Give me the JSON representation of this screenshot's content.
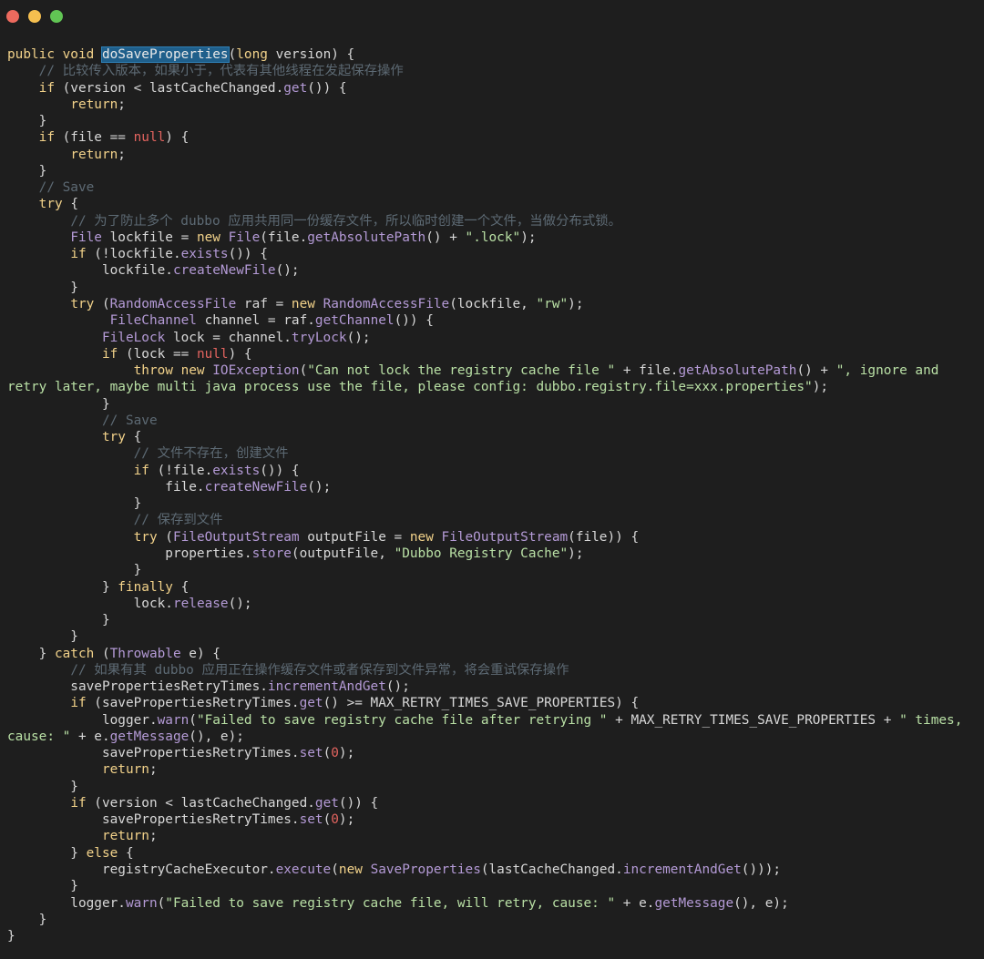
{
  "window": {
    "controls": {
      "close_color": "#ed6a5e",
      "minimize_color": "#f5bf4f",
      "maximize_color": "#61c554"
    }
  },
  "theme": {
    "background": "#1e1e1e",
    "keyword": "#f2d28a",
    "function": "#b49ad6",
    "string": "#b9e0a5",
    "number": "#e3645f",
    "comment": "#5d6a74",
    "plain": "#d8d8d8",
    "selection": "#1f5f8b"
  },
  "code": {
    "selected_identifier": "doSaveProperties",
    "lines": [
      [
        [
          "kw",
          "public void "
        ],
        [
          "hl",
          "doSaveProperties"
        ],
        [
          "op",
          "("
        ],
        [
          "kw",
          "long"
        ],
        [
          "op",
          " version) {"
        ]
      ],
      [
        [
          "op",
          "    "
        ],
        [
          "cmt",
          "// 比较传入版本，如果小于，代表有其他线程在发起保存操作"
        ]
      ],
      [
        [
          "op",
          "    "
        ],
        [
          "kw",
          "if"
        ],
        [
          "op",
          " (version < lastCacheChanged."
        ],
        [
          "fn",
          "get"
        ],
        [
          "op",
          "()) {"
        ]
      ],
      [
        [
          "op",
          "        "
        ],
        [
          "kw",
          "return"
        ],
        [
          "op",
          ";"
        ]
      ],
      [
        [
          "op",
          "    }"
        ]
      ],
      [
        [
          "op",
          "    "
        ],
        [
          "kw",
          "if"
        ],
        [
          "op",
          " (file == "
        ],
        [
          "num",
          "null"
        ],
        [
          "op",
          ") {"
        ]
      ],
      [
        [
          "op",
          "        "
        ],
        [
          "kw",
          "return"
        ],
        [
          "op",
          ";"
        ]
      ],
      [
        [
          "op",
          "    }"
        ]
      ],
      [
        [
          "op",
          "    "
        ],
        [
          "cmt",
          "// Save"
        ]
      ],
      [
        [
          "op",
          "    "
        ],
        [
          "kw",
          "try"
        ],
        [
          "op",
          " {"
        ]
      ],
      [
        [
          "op",
          "        "
        ],
        [
          "cmt",
          "// 为了防止多个 dubbo 应用共用同一份缓存文件，所以临时创建一个文件，当做分布式锁。"
        ]
      ],
      [
        [
          "op",
          "        "
        ],
        [
          "ty",
          "File"
        ],
        [
          "op",
          " lockfile = "
        ],
        [
          "kw",
          "new "
        ],
        [
          "ty",
          "File"
        ],
        [
          "op",
          "(file."
        ],
        [
          "fn",
          "getAbsolutePath"
        ],
        [
          "op",
          "() + "
        ],
        [
          "str",
          "\".lock\""
        ],
        [
          "op",
          ");"
        ]
      ],
      [
        [
          "op",
          "        "
        ],
        [
          "kw",
          "if"
        ],
        [
          "op",
          " (!lockfile."
        ],
        [
          "fn",
          "exists"
        ],
        [
          "op",
          "()) {"
        ]
      ],
      [
        [
          "op",
          "            lockfile."
        ],
        [
          "fn",
          "createNewFile"
        ],
        [
          "op",
          "();"
        ]
      ],
      [
        [
          "op",
          "        }"
        ]
      ],
      [
        [
          "op",
          "        "
        ],
        [
          "kw",
          "try"
        ],
        [
          "op",
          " ("
        ],
        [
          "ty",
          "RandomAccessFile"
        ],
        [
          "op",
          " raf = "
        ],
        [
          "kw",
          "new "
        ],
        [
          "ty",
          "RandomAccessFile"
        ],
        [
          "op",
          "(lockfile, "
        ],
        [
          "str",
          "\"rw\""
        ],
        [
          "op",
          ");"
        ]
      ],
      [
        [
          "op",
          "             "
        ],
        [
          "ty",
          "FileChannel"
        ],
        [
          "op",
          " channel = raf."
        ],
        [
          "fn",
          "getChannel"
        ],
        [
          "op",
          "()) {"
        ]
      ],
      [
        [
          "op",
          "            "
        ],
        [
          "ty",
          "FileLock"
        ],
        [
          "op",
          " lock = channel."
        ],
        [
          "fn",
          "tryLock"
        ],
        [
          "op",
          "();"
        ]
      ],
      [
        [
          "op",
          "            "
        ],
        [
          "kw",
          "if"
        ],
        [
          "op",
          " (lock == "
        ],
        [
          "num",
          "null"
        ],
        [
          "op",
          ") {"
        ]
      ],
      [
        [
          "op",
          "                "
        ],
        [
          "kw",
          "throw new "
        ],
        [
          "ty",
          "IOException"
        ],
        [
          "op",
          "("
        ],
        [
          "str",
          "\"Can not lock the registry cache file \""
        ],
        [
          "op",
          " + file."
        ],
        [
          "fn",
          "getAbsolutePath"
        ],
        [
          "op",
          "() + "
        ],
        [
          "str",
          "\", ignore and"
        ]
      ],
      [
        [
          "str",
          "retry later, maybe multi java process use the file, please config: dubbo.registry.file=xxx.properties\""
        ],
        [
          "op",
          ");"
        ]
      ],
      [
        [
          "op",
          "            }"
        ]
      ],
      [
        [
          "op",
          "            "
        ],
        [
          "cmt",
          "// Save"
        ]
      ],
      [
        [
          "op",
          "            "
        ],
        [
          "kw",
          "try"
        ],
        [
          "op",
          " {"
        ]
      ],
      [
        [
          "op",
          "                "
        ],
        [
          "cmt",
          "// 文件不存在，创建文件"
        ]
      ],
      [
        [
          "op",
          "                "
        ],
        [
          "kw",
          "if"
        ],
        [
          "op",
          " (!file."
        ],
        [
          "fn",
          "exists"
        ],
        [
          "op",
          "()) {"
        ]
      ],
      [
        [
          "op",
          "                    file."
        ],
        [
          "fn",
          "createNewFile"
        ],
        [
          "op",
          "();"
        ]
      ],
      [
        [
          "op",
          "                }"
        ]
      ],
      [
        [
          "op",
          "                "
        ],
        [
          "cmt",
          "// 保存到文件"
        ]
      ],
      [
        [
          "op",
          "                "
        ],
        [
          "kw",
          "try"
        ],
        [
          "op",
          " ("
        ],
        [
          "ty",
          "FileOutputStream"
        ],
        [
          "op",
          " outputFile = "
        ],
        [
          "kw",
          "new "
        ],
        [
          "ty",
          "FileOutputStream"
        ],
        [
          "op",
          "(file)) {"
        ]
      ],
      [
        [
          "op",
          "                    properties."
        ],
        [
          "fn",
          "store"
        ],
        [
          "op",
          "(outputFile, "
        ],
        [
          "str",
          "\"Dubbo Registry Cache\""
        ],
        [
          "op",
          ");"
        ]
      ],
      [
        [
          "op",
          "                }"
        ]
      ],
      [
        [
          "op",
          "            } "
        ],
        [
          "kw",
          "finally"
        ],
        [
          "op",
          " {"
        ]
      ],
      [
        [
          "op",
          "                lock."
        ],
        [
          "fn",
          "release"
        ],
        [
          "op",
          "();"
        ]
      ],
      [
        [
          "op",
          "            }"
        ]
      ],
      [
        [
          "op",
          "        }"
        ]
      ],
      [
        [
          "op",
          "    } "
        ],
        [
          "kw",
          "catch"
        ],
        [
          "op",
          " ("
        ],
        [
          "ty",
          "Throwable"
        ],
        [
          "op",
          " e) {"
        ]
      ],
      [
        [
          "op",
          "        "
        ],
        [
          "cmt",
          "// 如果有其 dubbo 应用正在操作缓存文件或者保存到文件异常，将会重试保存操作"
        ]
      ],
      [
        [
          "op",
          "        savePropertiesRetryTimes."
        ],
        [
          "fn",
          "incrementAndGet"
        ],
        [
          "op",
          "();"
        ]
      ],
      [
        [
          "op",
          "        "
        ],
        [
          "kw",
          "if"
        ],
        [
          "op",
          " (savePropertiesRetryTimes."
        ],
        [
          "fn",
          "get"
        ],
        [
          "op",
          "() >= MAX_RETRY_TIMES_SAVE_PROPERTIES) {"
        ]
      ],
      [
        [
          "op",
          "            logger."
        ],
        [
          "fn",
          "warn"
        ],
        [
          "op",
          "("
        ],
        [
          "str",
          "\"Failed to save registry cache file after retrying \""
        ],
        [
          "op",
          " + MAX_RETRY_TIMES_SAVE_PROPERTIES + "
        ],
        [
          "str",
          "\" times,"
        ]
      ],
      [
        [
          "str",
          "cause: \""
        ],
        [
          "op",
          " + e."
        ],
        [
          "fn",
          "getMessage"
        ],
        [
          "op",
          "(), e);"
        ]
      ],
      [
        [
          "op",
          "            savePropertiesRetryTimes."
        ],
        [
          "fn",
          "set"
        ],
        [
          "op",
          "("
        ],
        [
          "num",
          "0"
        ],
        [
          "op",
          ");"
        ]
      ],
      [
        [
          "op",
          "            "
        ],
        [
          "kw",
          "return"
        ],
        [
          "op",
          ";"
        ]
      ],
      [
        [
          "op",
          "        }"
        ]
      ],
      [
        [
          "op",
          "        "
        ],
        [
          "kw",
          "if"
        ],
        [
          "op",
          " (version < lastCacheChanged."
        ],
        [
          "fn",
          "get"
        ],
        [
          "op",
          "()) {"
        ]
      ],
      [
        [
          "op",
          "            savePropertiesRetryTimes."
        ],
        [
          "fn",
          "set"
        ],
        [
          "op",
          "("
        ],
        [
          "num",
          "0"
        ],
        [
          "op",
          ");"
        ]
      ],
      [
        [
          "op",
          "            "
        ],
        [
          "kw",
          "return"
        ],
        [
          "op",
          ";"
        ]
      ],
      [
        [
          "op",
          "        } "
        ],
        [
          "kw",
          "else"
        ],
        [
          "op",
          " {"
        ]
      ],
      [
        [
          "op",
          "            registryCacheExecutor."
        ],
        [
          "fn",
          "execute"
        ],
        [
          "op",
          "("
        ],
        [
          "kw",
          "new "
        ],
        [
          "ty",
          "SaveProperties"
        ],
        [
          "op",
          "(lastCacheChanged."
        ],
        [
          "fn",
          "incrementAndGet"
        ],
        [
          "op",
          "()));"
        ]
      ],
      [
        [
          "op",
          "        }"
        ]
      ],
      [
        [
          "op",
          "        logger."
        ],
        [
          "fn",
          "warn"
        ],
        [
          "op",
          "("
        ],
        [
          "str",
          "\"Failed to save registry cache file, will retry, cause: \""
        ],
        [
          "op",
          " + e."
        ],
        [
          "fn",
          "getMessage"
        ],
        [
          "op",
          "(), e);"
        ]
      ],
      [
        [
          "op",
          "    }"
        ]
      ],
      [
        [
          "op",
          "}"
        ]
      ]
    ]
  }
}
